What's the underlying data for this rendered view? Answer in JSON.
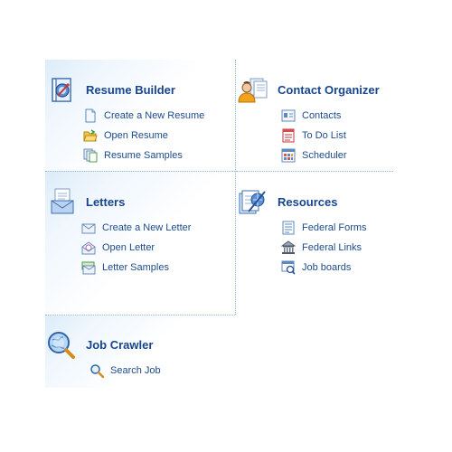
{
  "sections": {
    "resume_builder": {
      "title": "Resume Builder",
      "icon": "resume-compass-icon",
      "links": [
        {
          "label": "Create a New Resume",
          "icon": "new-document-icon"
        },
        {
          "label": "Open Resume",
          "icon": "open-folder-icon"
        },
        {
          "label": "Resume Samples",
          "icon": "documents-stack-icon"
        }
      ]
    },
    "contact_organizer": {
      "title": "Contact Organizer",
      "icon": "contact-person-icon",
      "links": [
        {
          "label": "Contacts",
          "icon": "address-card-icon"
        },
        {
          "label": "To Do List",
          "icon": "todo-list-icon"
        },
        {
          "label": "Scheduler",
          "icon": "calendar-grid-icon"
        }
      ]
    },
    "letters": {
      "title": "Letters",
      "icon": "letter-envelope-icon",
      "links": [
        {
          "label": "Create a New Letter",
          "icon": "new-envelope-icon"
        },
        {
          "label": "Open Letter",
          "icon": "open-envelope-icon"
        },
        {
          "label": "Letter Samples",
          "icon": "envelope-stack-icon"
        }
      ]
    },
    "resources": {
      "title": "Resources",
      "icon": "resources-book-icon",
      "links": [
        {
          "label": "Federal Forms",
          "icon": "form-document-icon"
        },
        {
          "label": "Federal Links",
          "icon": "federal-building-icon"
        },
        {
          "label": "Job boards",
          "icon": "job-board-icon"
        }
      ]
    },
    "job_crawler": {
      "title": "Job Crawler",
      "icon": "globe-magnifier-icon",
      "links": [
        {
          "label": "Search Job",
          "icon": "search-icon"
        }
      ]
    }
  },
  "colors": {
    "title": "#17458f",
    "link": "#1d4a8c",
    "divider": "#8fb6d8",
    "panel_tint": "#dcecf9"
  }
}
